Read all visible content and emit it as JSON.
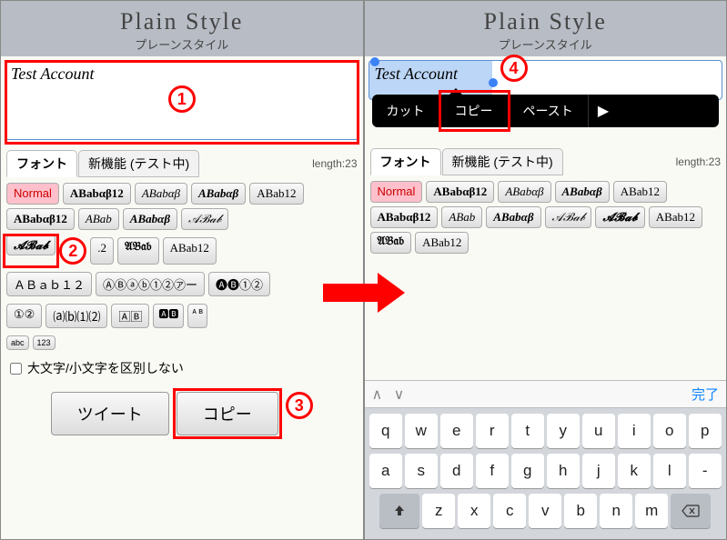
{
  "app": {
    "title": "Plain Style",
    "subtitle": "プレーンスタイル"
  },
  "textarea": {
    "value": "Test Account"
  },
  "length_label": "length:23",
  "tabs": {
    "font": "フォント",
    "newfeatures": "新機能 (テスト中)"
  },
  "fonts": {
    "normal": "Normal",
    "serif_bold": "ABabαβ12",
    "serif_italic": "ABabαβ",
    "serif_bolditalic": "ABabαβ",
    "sans_12": "ABab12",
    "sans_bold_ab12": "ABabαβ12",
    "sans_italic_ab": "ABab",
    "sans_bolditalic": "ABabαβ",
    "script_light": "𝒜ℬ𝒶𝒷",
    "script_bold": "𝓐𝓑𝓪𝓫",
    "fraktur_12": ".2",
    "fraktur_bold": "𝔄𝔅𝔞𝔟",
    "sans_ab12": "ABab12",
    "mono_12": "ＡＢａｂ１２",
    "circled": "ⒶⒷⓐⓑ①②㋐ー",
    "negcircled": "🅐🅑①②",
    "circled12": "①②",
    "paren": "⒜⒝⑴⑵",
    "inv_square": "🄰🄱",
    "box_neg": "🅰🅱",
    "small_ab": "ᴀ ʙ",
    "tiny_abc": "abc",
    "tiny_123": "123",
    "r2_ab12": "ABab12"
  },
  "checkbox_label": "大文字/小文字を区別しない",
  "actions": {
    "tweet": "ツイート",
    "copy": "コピー"
  },
  "context_menu": {
    "cut": "カット",
    "copy": "コピー",
    "paste": "ペースト"
  },
  "keyboard": {
    "done": "完了",
    "row1": [
      "q",
      "w",
      "e",
      "r",
      "t",
      "y",
      "u",
      "i",
      "o",
      "p"
    ],
    "row2": [
      "a",
      "s",
      "d",
      "f",
      "g",
      "h",
      "j",
      "k",
      "l",
      "-"
    ],
    "row3": [
      "z",
      "x",
      "c",
      "v",
      "b",
      "n",
      "m"
    ]
  },
  "annotations": {
    "n1": "1",
    "n2": "2",
    "n3": "3",
    "n4": "4"
  }
}
